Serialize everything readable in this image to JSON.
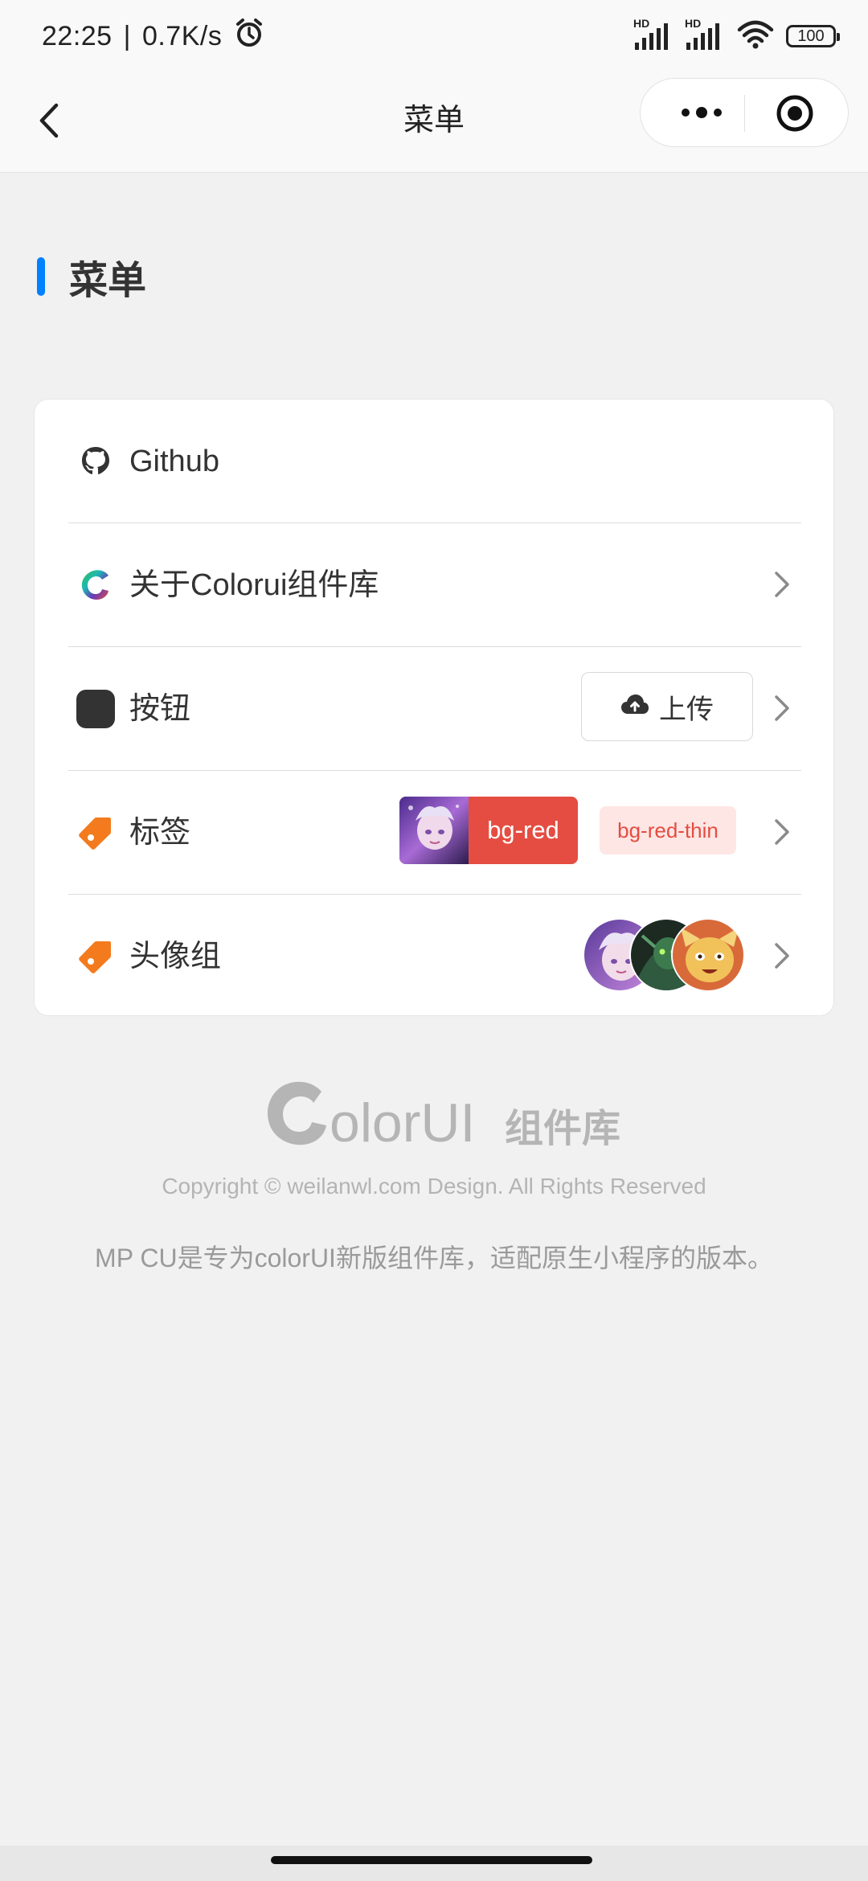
{
  "status_bar": {
    "time": "22:25",
    "separator": "|",
    "speed": "0.7K/s",
    "hd1": "HD",
    "hd2": "HD",
    "battery": "100",
    "icons": [
      "alarm-icon",
      "signal-icon",
      "signal-icon",
      "wifi-icon",
      "battery-icon"
    ]
  },
  "nav": {
    "title": "菜单",
    "icons": [
      "back-icon",
      "more-icon",
      "close-target-icon"
    ]
  },
  "section": {
    "title": "菜单",
    "accent_color": "#0081ff"
  },
  "menu": {
    "items": [
      {
        "label": "Github",
        "icon": "github-icon"
      },
      {
        "label": "关于Colorui组件库",
        "icon": "colorui-logo-icon",
        "arrow": "chevron-right-icon"
      },
      {
        "label": "按钮",
        "icon": "rounded-square-icon",
        "arrow": "chevron-right-icon"
      },
      {
        "label": "标签",
        "icon": "tag-icon",
        "arrow": "chevron-right-icon"
      },
      {
        "label": "头像组",
        "icon": "tag-icon",
        "arrow": "chevron-right-icon"
      }
    ],
    "upload_button": {
      "label": "上传",
      "icon": "cloud-upload-icon"
    },
    "tags": [
      {
        "label": "bg-red",
        "color": "#e54d42"
      },
      {
        "label": "bg-red-thin",
        "color": "#e54d42",
        "bg": "#fde6e4"
      }
    ],
    "icon_color_tag": "#f37b1d"
  },
  "footer": {
    "logo_text": "olorUI",
    "logo_cn": "组件库",
    "copyright": "Copyright © weilanwl.com Design. All Rights Reserved",
    "description": "MP CU是专为colorUI新版组件库，适配原生小程序的版本。"
  }
}
